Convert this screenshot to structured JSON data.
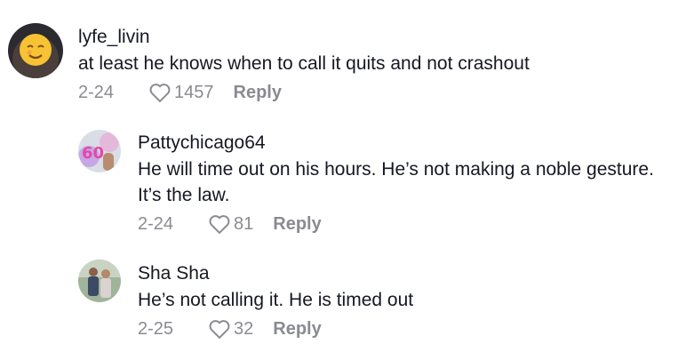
{
  "comments": [
    {
      "username": "lyfe_livin",
      "text": "at least he knows when to call it quits and not crashout",
      "date": "2-24",
      "likes": "1457",
      "reply_label": "Reply"
    },
    {
      "username": "Pattychicago64",
      "text_line1": "He will time out on his hours. He’s not making a noble gesture.",
      "text_line2": "It’s the law.",
      "date": "2-24",
      "likes": "81",
      "reply_label": "Reply"
    },
    {
      "username": "Sha Sha",
      "text": "He’s not calling it. He is timed out",
      "date": "2-25",
      "likes": "32",
      "reply_label": "Reply"
    }
  ],
  "icons": {
    "like": "heart-outline-icon"
  },
  "colors": {
    "text": "#161823",
    "meta": "#8a8b91"
  }
}
